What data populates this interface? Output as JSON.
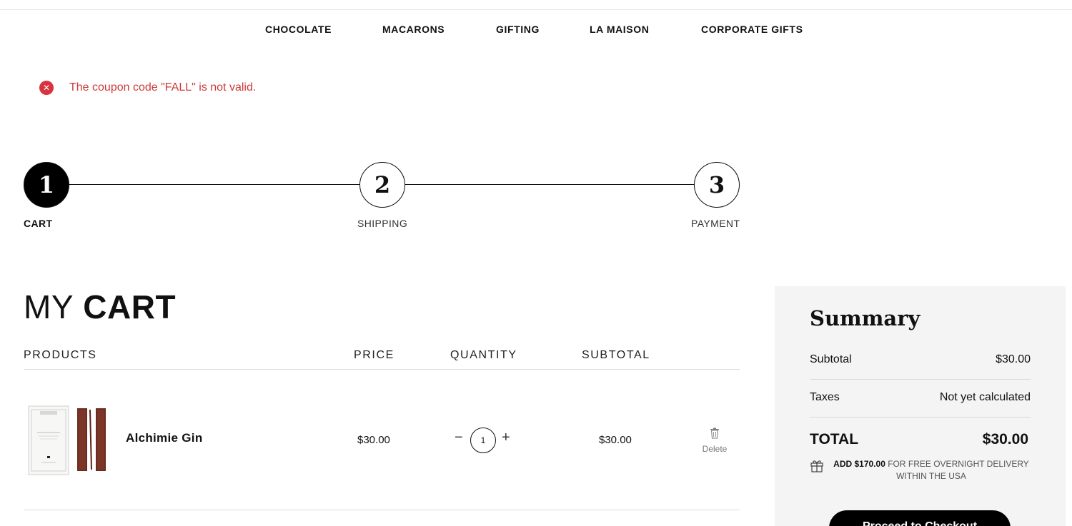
{
  "nav": {
    "items": [
      "CHOCOLATE",
      "MACARONS",
      "GIFTING",
      "LA MAISON",
      "CORPORATE GIFTS"
    ]
  },
  "alert": {
    "icon": "error-x-icon",
    "message": "The coupon code \"FALL\" is not valid.",
    "color": "#cc3a3a"
  },
  "steps": [
    {
      "number": "1",
      "label": "CART",
      "active": true
    },
    {
      "number": "2",
      "label": "SHIPPING",
      "active": false
    },
    {
      "number": "3",
      "label": "PAYMENT",
      "active": false
    }
  ],
  "cart": {
    "title_light": "MY",
    "title_bold": "CART",
    "columns": [
      "PRODUCTS",
      "PRICE",
      "QUANTITY",
      "SUBTOTAL"
    ],
    "items": [
      {
        "name": "Alchimie Gin",
        "price": "$30.00",
        "quantity": "1",
        "subtotal": "$30.00",
        "delete_label": "Delete",
        "minus": "−",
        "plus": "+"
      }
    ]
  },
  "summary": {
    "title": "Summary",
    "subtotal_label": "Subtotal",
    "subtotal_value": "$30.00",
    "taxes_label": "Taxes",
    "taxes_value": "Not yet calculated",
    "total_label": "TOTAL",
    "total_value": "$30.00",
    "promo_amount": "ADD $170.00",
    "promo_text": "FOR FREE OVERNIGHT DELIVERY WITHIN THE USA",
    "checkout_label": "Proceed to Checkout"
  }
}
